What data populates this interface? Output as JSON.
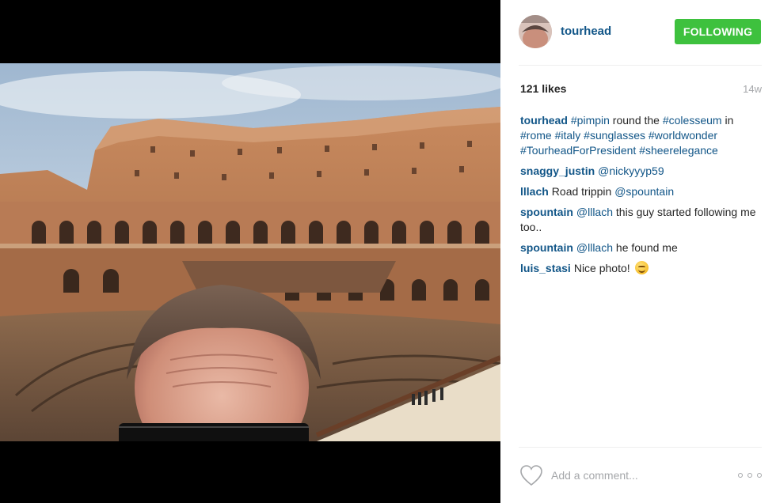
{
  "post": {
    "author": "tourhead",
    "follow_label": "FOLLOWING",
    "likes": "121 likes",
    "age": "14w"
  },
  "caption": {
    "user": "tourhead",
    "parts": [
      {
        "type": "tag",
        "text": "#pimpin"
      },
      {
        "type": "text",
        "text": " round the "
      },
      {
        "type": "tag",
        "text": "#colesseum"
      },
      {
        "type": "text",
        "text": " in "
      },
      {
        "type": "tag",
        "text": "#rome"
      },
      {
        "type": "text",
        "text": " "
      },
      {
        "type": "tag",
        "text": "#italy"
      },
      {
        "type": "text",
        "text": " "
      },
      {
        "type": "tag",
        "text": "#sunglasses"
      },
      {
        "type": "text",
        "text": " "
      },
      {
        "type": "tag",
        "text": "#worldwonder"
      },
      {
        "type": "text",
        "text": " "
      },
      {
        "type": "tag",
        "text": "#TourheadForPresident"
      },
      {
        "type": "text",
        "text": " "
      },
      {
        "type": "tag",
        "text": "#sheerelegance"
      }
    ]
  },
  "comments": [
    {
      "user": "snaggy_justin",
      "parts": [
        {
          "type": "tag",
          "text": "@nickyyyp59"
        }
      ]
    },
    {
      "user": "lllach",
      "parts": [
        {
          "type": "text",
          "text": "Road trippin "
        },
        {
          "type": "tag",
          "text": "@spountain"
        }
      ]
    },
    {
      "user": "spountain",
      "parts": [
        {
          "type": "tag",
          "text": "@lllach"
        },
        {
          "type": "text",
          "text": " this guy started following me too.."
        }
      ]
    },
    {
      "user": "spountain",
      "parts": [
        {
          "type": "tag",
          "text": "@lllach"
        },
        {
          "type": "text",
          "text": " he found me"
        }
      ]
    },
    {
      "user": "luis_stasi",
      "parts": [
        {
          "type": "text",
          "text": "Nice photo! "
        },
        {
          "type": "emoji",
          "text": "smiling-face-emoji"
        }
      ]
    }
  ],
  "footer": {
    "comment_placeholder": "Add a comment...",
    "like_icon": "heart-outline-icon",
    "more_icon": "more-options-icon"
  },
  "colors": {
    "link": "#125688",
    "follow_button": "#3ec13e",
    "muted": "#a5a7aa"
  }
}
